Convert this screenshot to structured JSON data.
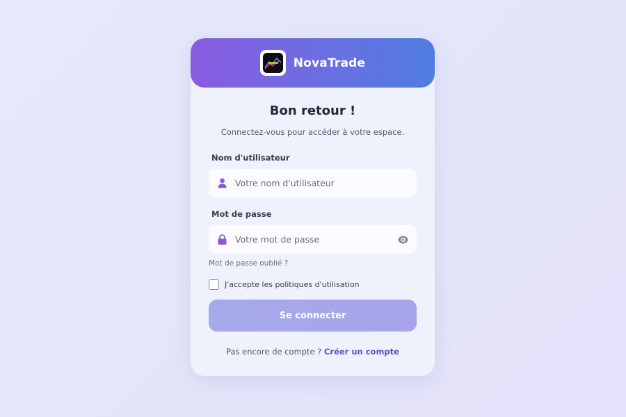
{
  "brand": {
    "name": "NovaTrade",
    "header_gradient": [
      "#8a5be0",
      "#4f7de0"
    ]
  },
  "login": {
    "title": "Bon retour !",
    "subtitle": "Connectez-vous pour accéder à votre espace.",
    "username": {
      "label": "Nom d'utilisateur",
      "placeholder": "Votre nom d'utilisateur",
      "value": "",
      "icon": "user-icon"
    },
    "password": {
      "label": "Mot de passe",
      "placeholder": "Votre mot de passe",
      "value": "",
      "icon": "lock-icon",
      "toggle_icon": "eye-icon"
    },
    "forgot_link": "Mot de passe oublié ?",
    "accept_label": "J'accepte les politiques d'utilisation",
    "accept_checked": false,
    "submit_label": "Se connecter",
    "signup_prompt": "Pas encore de compte ?",
    "signup_link": "Créer un compte"
  },
  "colors": {
    "accent": "#8a5ad6",
    "link": "#5a56c8",
    "button": "#a7a7ea"
  }
}
